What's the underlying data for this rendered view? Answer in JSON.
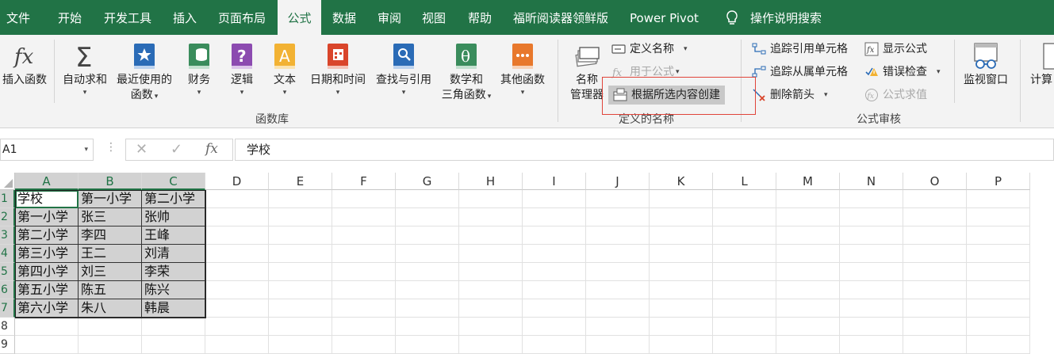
{
  "tabs": [
    "文件",
    "开始",
    "开发工具",
    "插入",
    "页面布局",
    "公式",
    "数据",
    "审阅",
    "视图",
    "帮助",
    "福昕阅读器领鲜版",
    "Power Pivot",
    "操作说明搜索"
  ],
  "active_tab": "公式",
  "ribbon": {
    "function_library": {
      "insert_function": "插入函数",
      "autosum": "自动求和",
      "recent_line1": "最近使用的",
      "recent_line2": "函数",
      "financial": "财务",
      "logical": "逻辑",
      "text": "文本",
      "datetime": "日期和时间",
      "lookup": "查找与引用",
      "math_line1": "数学和",
      "math_line2": "三角函数",
      "more": "其他函数",
      "group_label": "函数库"
    },
    "defined_names": {
      "name_manager_line1": "名称",
      "name_manager_line2": "管理器",
      "define_name": "定义名称",
      "use_in_formula": "用于公式",
      "create_from_selection": "根据所选内容创建",
      "group_label": "定义的名称"
    },
    "formula_auditing": {
      "trace_precedents": "追踪引用单元格",
      "trace_dependents": "追踪从属单元格",
      "remove_arrows": "删除箭头",
      "show_formulas": "显示公式",
      "error_checking": "错误检查",
      "evaluate_formula": "公式求值",
      "group_label": "公式审核"
    },
    "watch_window": "监视窗口",
    "calculation": "计算"
  },
  "formula_bar": {
    "name_box": "A1",
    "fx": "fx",
    "content": "学校"
  },
  "grid": {
    "columns": [
      "A",
      "B",
      "C",
      "D",
      "E",
      "F",
      "G",
      "H",
      "I",
      "J",
      "K",
      "L",
      "M",
      "N",
      "O",
      "P"
    ],
    "rows": [
      "1",
      "2",
      "3",
      "4",
      "5",
      "6",
      "7",
      "8",
      "9"
    ],
    "cells": [
      [
        "学校",
        "第一小学",
        "第二小学"
      ],
      [
        "第一小学",
        "张三",
        "张帅"
      ],
      [
        "第二小学",
        "李四",
        "王峰"
      ],
      [
        "第三小学",
        "王二",
        "刘清"
      ],
      [
        "第四小学",
        "刘三",
        "李荣"
      ],
      [
        "第五小学",
        "陈五",
        "陈兴"
      ],
      [
        "第六小学",
        "朱八",
        "韩晨"
      ]
    ]
  },
  "colors": {
    "brand_green": "#217346",
    "highlight_box": "#e0443a"
  }
}
